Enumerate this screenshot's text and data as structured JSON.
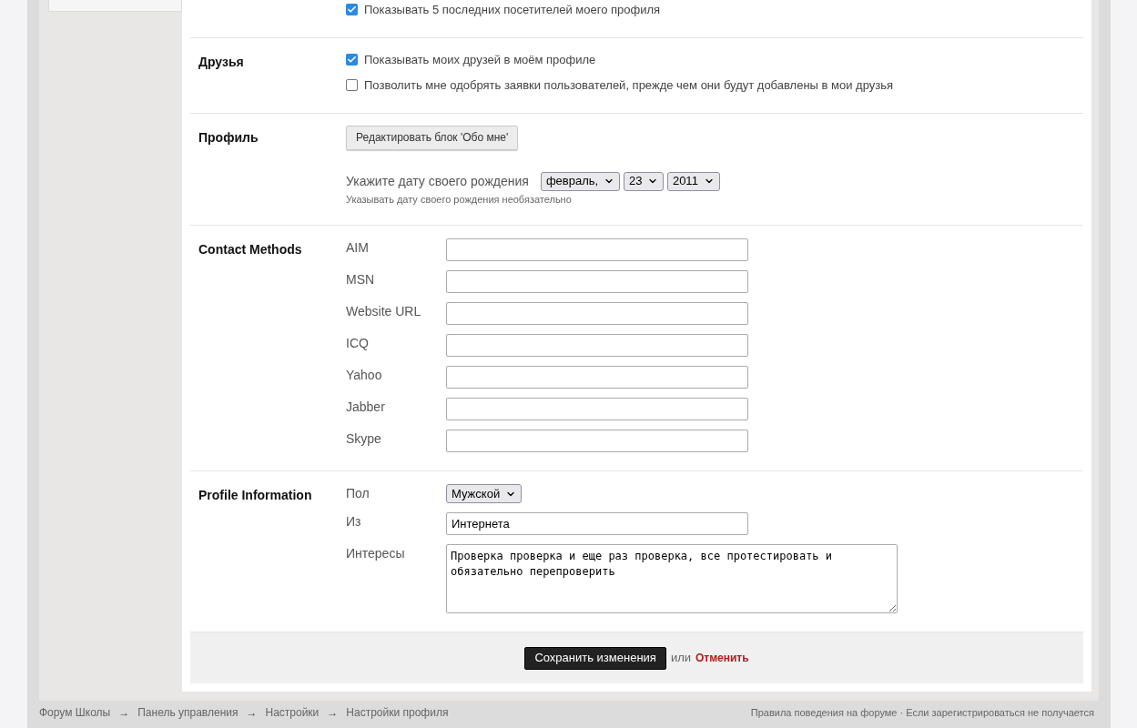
{
  "sections": [
    {
      "kind": "checks",
      "options": [
        {
          "label": "Показывать 5 последних посетителей моего профиля",
          "checked": true
        }
      ]
    },
    {
      "kind": "checks",
      "title": "Друзья",
      "options": [
        {
          "label": "Показывать моих друзей в моём профиле",
          "checked": true
        },
        {
          "label": "Позволить мне одобрять заявки пользователей, прежде чем они будут добавлены в мои друзья",
          "checked": false
        }
      ]
    },
    {
      "kind": "profile",
      "title": "Профиль",
      "button": "Редактировать блок 'Обо мне'",
      "birthday": {
        "label": "Укажите дату своего рождения",
        "month": "февраль,",
        "day": "23",
        "year": "2011",
        "hint": "Указывать дату своего рождения необязательно"
      }
    },
    {
      "kind": "fields",
      "title": "Contact Methods",
      "fields": [
        {
          "kind": "input",
          "label": "AIM"
        },
        {
          "kind": "input",
          "label": "MSN"
        },
        {
          "kind": "input",
          "label": "Website URL"
        },
        {
          "kind": "input",
          "label": "ICQ"
        },
        {
          "kind": "input",
          "label": "Yahoo"
        },
        {
          "kind": "input",
          "label": "Jabber"
        },
        {
          "kind": "input",
          "label": "Skype"
        }
      ]
    },
    {
      "kind": "fields",
      "title": "Profile Information",
      "fields": [
        {
          "kind": "select",
          "label": "Пол",
          "value": "Мужской"
        },
        {
          "kind": "input",
          "label": "Из",
          "value": "Интернета"
        },
        {
          "kind": "textarea",
          "label": "Интересы",
          "value": "Проверка проверка и еще раз проверка, все протестировать и обязательно перепроверить"
        }
      ]
    }
  ],
  "actions": {
    "save": "Сохранить изменения",
    "or": "или",
    "cancel": "Отменить"
  },
  "breadcrumbs": [
    {
      "label": "Форум Школы",
      "arrow": "→"
    },
    {
      "label": "Панель управления",
      "arrow": "→"
    },
    {
      "label": "Настройки",
      "arrow": "→"
    },
    {
      "label": "Настройки профиля"
    }
  ],
  "footer_links": "Правила поведения на форуме · Если зарегистрироваться не получается"
}
